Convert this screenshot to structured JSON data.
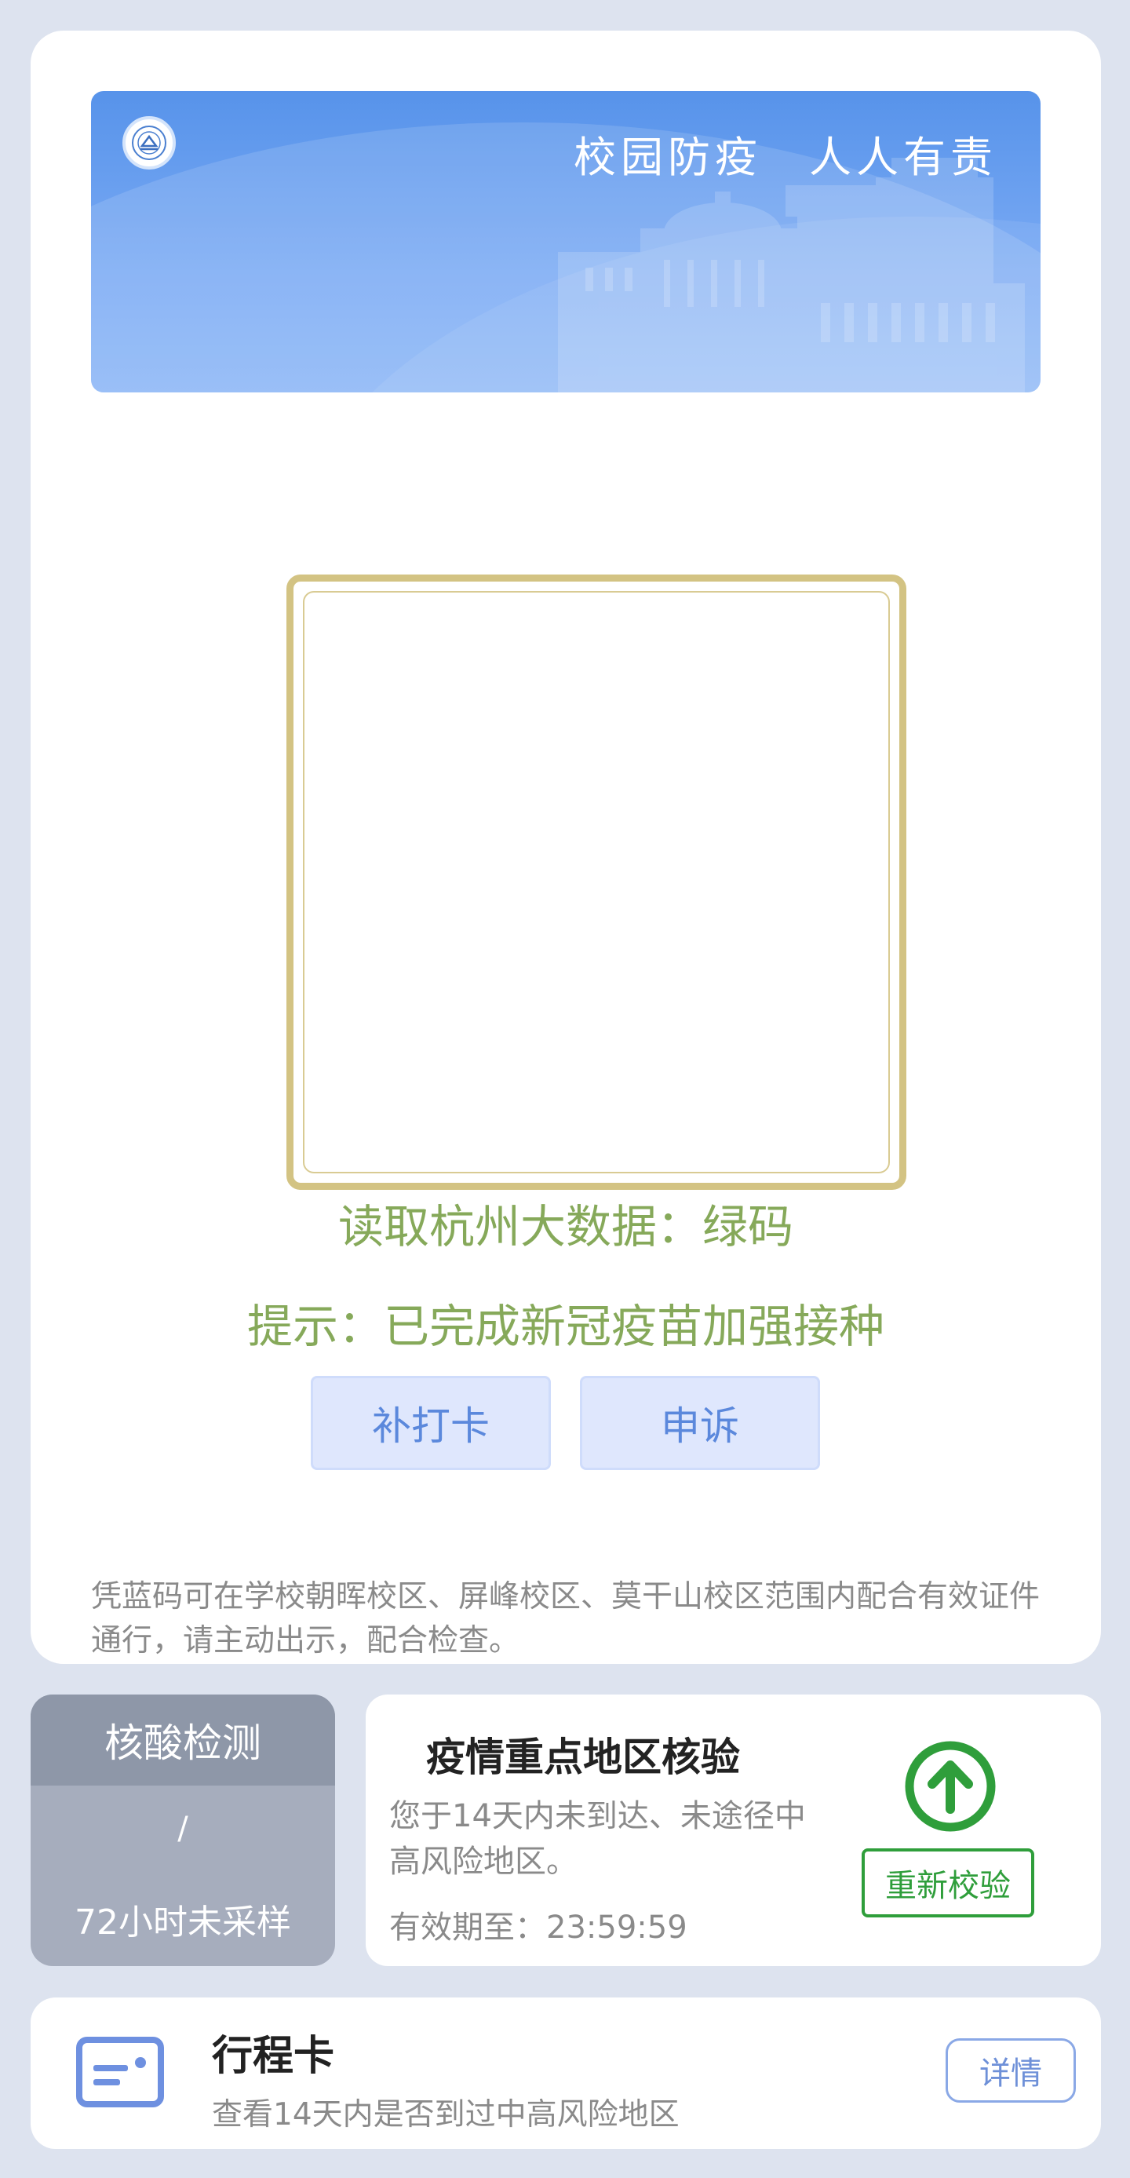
{
  "banner": {
    "slogan_left": "校园防疫",
    "slogan_right": "人人有责",
    "logo_icon": "university-seal-icon"
  },
  "code": {
    "status": "读取杭州大数据：绿码",
    "tip": "提示：已完成新冠疫苗加强接种",
    "frame_color": "#d3c383",
    "status_color": "#86a95a"
  },
  "actions": {
    "checkin_label": "补打卡",
    "appeal_label": "申诉"
  },
  "notice": "凭蓝码可在学校朝晖校区、屏峰校区、莫干山校区范围内配合有效证件通行，请主动出示，配合检查。",
  "nucleic": {
    "title": "核酸检测",
    "value": "/",
    "status": "72小时未采样"
  },
  "region_check": {
    "title": "疫情重点地区核验",
    "description": "您于14天内未到达、未途径中高风险地区。",
    "valid_until": "有效期至：23:59:59",
    "recheck_label": "重新校验",
    "icon": "up-arrow-circle-icon",
    "accent_color": "#2f9e3b"
  },
  "trip": {
    "title": "行程卡",
    "subtitle": "查看14天内是否到过中高风险地区",
    "detail_label": "详情",
    "icon": "id-card-icon"
  }
}
